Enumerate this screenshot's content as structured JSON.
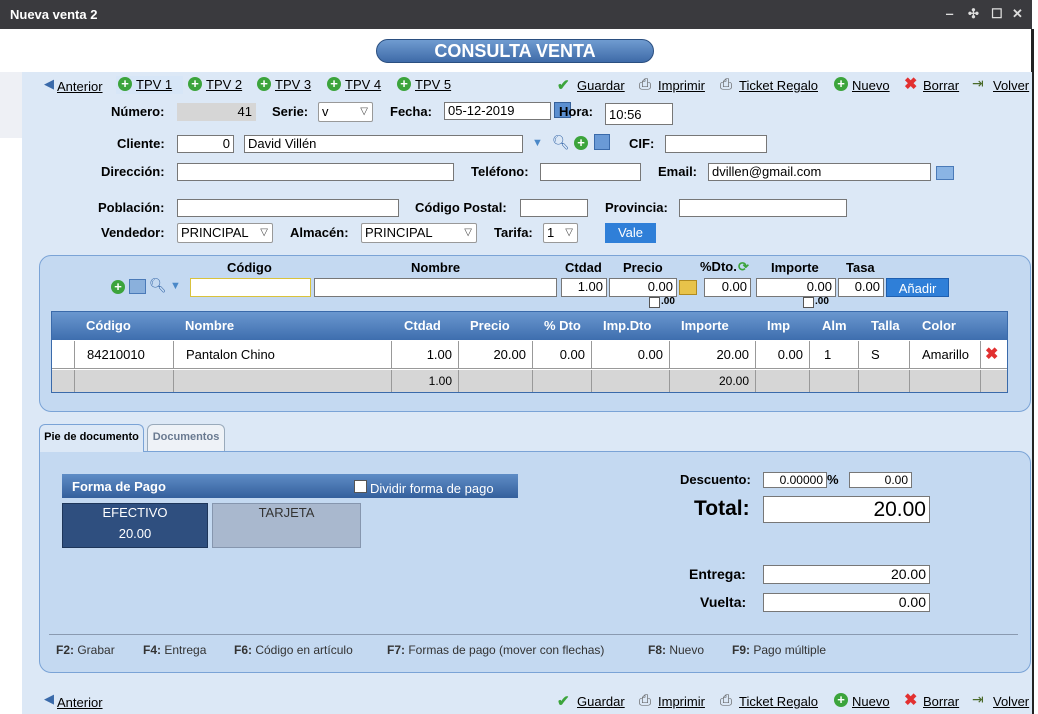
{
  "window": {
    "title": "Nueva venta 2",
    "controls": [
      "‒",
      "✣",
      "☐",
      "✕"
    ]
  },
  "banner": "CONSULTA VENTA",
  "nav": {
    "anterior": "Anterior",
    "tpv": [
      "TPV 1",
      "TPV 2",
      "TPV 3",
      "TPV 4",
      "TPV 5"
    ],
    "guardar": "Guardar",
    "imprimir": "Imprimir",
    "ticket_regalo": "Ticket Regalo",
    "nuevo": "Nuevo",
    "borrar": "Borrar",
    "volver": "Volver"
  },
  "header": {
    "numero_label": "Número:",
    "numero": "41",
    "serie_label": "Serie:",
    "serie": "v",
    "fecha_label": "Fecha:",
    "fecha": "05-12-2019",
    "hora_label": "Hora:",
    "hora": "10:56",
    "cliente_label": "Cliente:",
    "cliente_id": "0",
    "cliente_nombre": "David Villén",
    "cif_label": "CIF:",
    "cif": "",
    "direccion_label": "Dirección:",
    "direccion": "",
    "telefono_label": "Teléfono:",
    "telefono": "",
    "email_label": "Email:",
    "email": "dvillen@gmail.com",
    "poblacion_label": "Población:",
    "poblacion": "",
    "cp_label": "Código Postal:",
    "cp": "",
    "provincia_label": "Provincia:",
    "provincia": "",
    "vendedor_label": "Vendedor:",
    "vendedor": "PRINCIPAL",
    "almacen_label": "Almacén:",
    "almacen": "PRINCIPAL",
    "tarifa_label": "Tarifa:",
    "tarifa": "1",
    "vale": "Vale"
  },
  "entry": {
    "codigo_label": "Código",
    "nombre_label": "Nombre",
    "ctdad_label": "Ctdad",
    "precio_label": "Precio",
    "dto_label": "%Dto.",
    "importe_label": "Importe",
    "tasa_label": "Tasa",
    "codigo": "",
    "nombre": "",
    "ctdad": "1.00",
    "precio": "0.00",
    "precio_sub": ".00",
    "dto": "0.00",
    "importe": "0.00",
    "importe_sub": ".00",
    "tasa": "0.00",
    "anadir": "Añadir"
  },
  "grid": {
    "headers": [
      "Código",
      "Nombre",
      "Ctdad",
      "Precio",
      "% Dto",
      "Imp.Dto",
      "Importe",
      "Imp",
      "Alm",
      "Talla",
      "Color"
    ],
    "row": {
      "codigo": "84210010",
      "nombre": "Pantalon Chino",
      "ctdad": "1.00",
      "precio": "20.00",
      "dto": "0.00",
      "impdto": "0.00",
      "importe": "20.00",
      "imp": "0.00",
      "alm": "1",
      "talla": "S",
      "color": "Amarillo"
    },
    "totals": {
      "ctdad": "1.00",
      "importe": "20.00"
    }
  },
  "tabs": [
    "Pie de documento",
    "Documentos"
  ],
  "pago": {
    "title": "Forma de Pago",
    "dividir": "Dividir forma de pago",
    "efectivo": "EFECTIVO",
    "efectivo_amount": "20.00",
    "tarjeta": "TARJETA"
  },
  "totales": {
    "descuento_label": "Descuento:",
    "descuento_pct": "0.00000",
    "pct_sign": "%",
    "descuento": "0.00",
    "total_label": "Total:",
    "total": "20.00",
    "entrega_label": "Entrega:",
    "entrega": "20.00",
    "vuelta_label": "Vuelta:",
    "vuelta": "0.00"
  },
  "shortcuts": [
    {
      "key": "F2:",
      "text": "Grabar"
    },
    {
      "key": "F4:",
      "text": "Entrega"
    },
    {
      "key": "F6:",
      "text": "Código en artículo"
    },
    {
      "key": "F7:",
      "text": "Formas de pago (mover con flechas)"
    },
    {
      "key": "F8:",
      "text": "Nuevo"
    },
    {
      "key": "F9:",
      "text": "Pago múltiple"
    }
  ],
  "colors": {
    "accent": "#2f7fd8",
    "panel": "#c4d9f1",
    "header_grid": "#3e6eae"
  }
}
